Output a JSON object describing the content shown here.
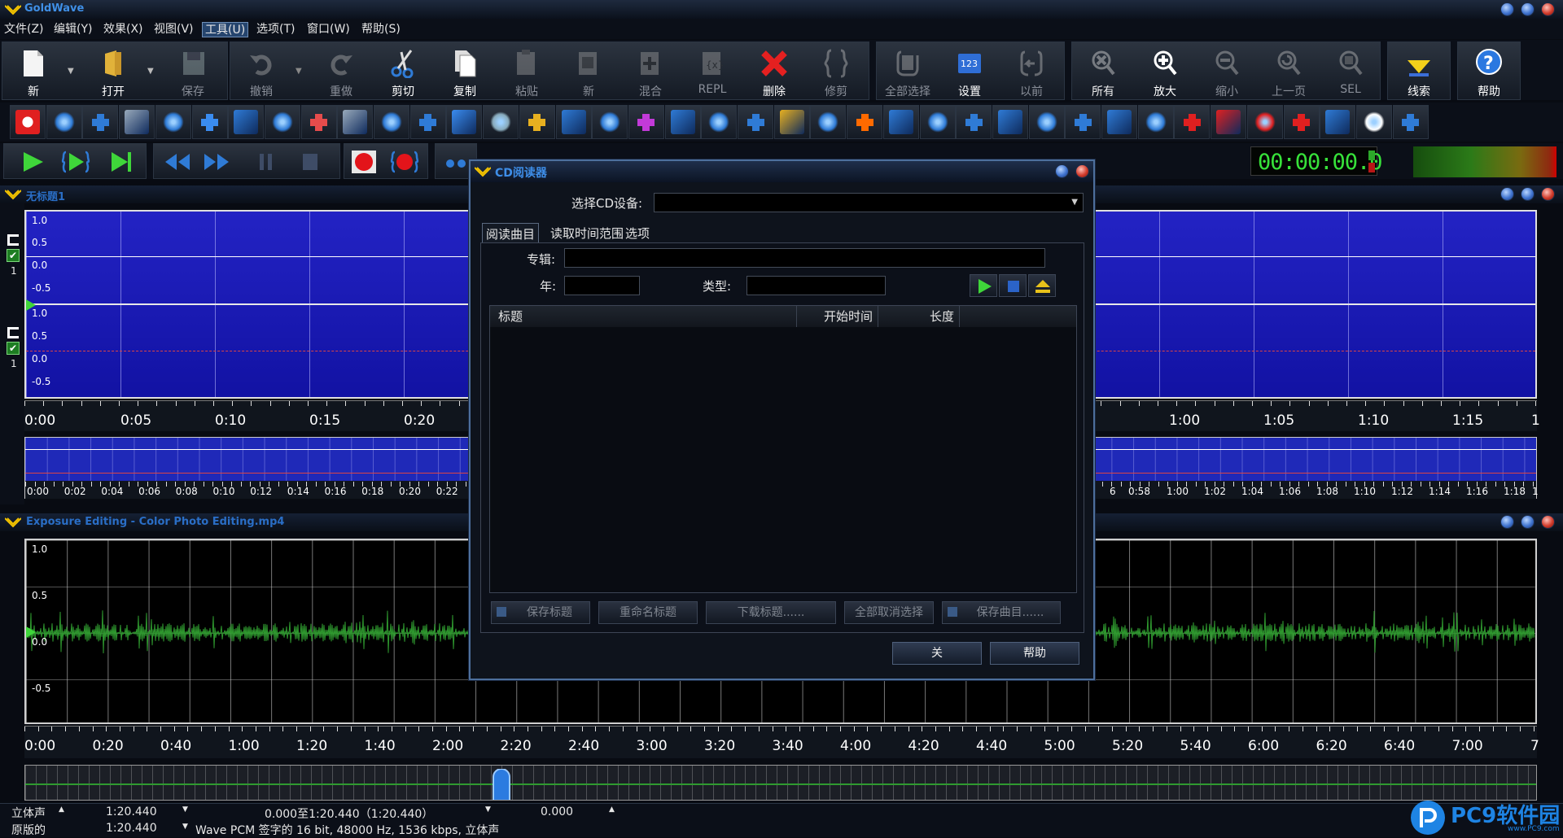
{
  "app": {
    "title": "GoldWave"
  },
  "menu": [
    "文件(Z)",
    "编辑(Y)",
    "效果(X)",
    "视图(V)",
    "工具(U)",
    "选项(T)",
    "窗口(W)",
    "帮助(S)"
  ],
  "toolbar": {
    "new": "新",
    "open": "打开",
    "save": "保存",
    "undo": "撤销",
    "redo": "重做",
    "cut": "剪切",
    "copy": "复制",
    "paste": "粘贴",
    "paste_new": "新",
    "mix": "混合",
    "replace": "REPL",
    "delete": "删除",
    "trim": "修剪",
    "select_all": "全部选择",
    "settings": "设置",
    "previous": "以前",
    "zoom_all": "所有",
    "zoom_in": "放大",
    "zoom_out": "缩小",
    "prev_page": "上一页",
    "sel": "SEL",
    "cue": "线索",
    "help": "帮助"
  },
  "time_display": "00:00:00.0",
  "panel1": {
    "title": "无标题1",
    "ylabels_top": [
      "1.0",
      "0.5",
      "0.0",
      "-0.5"
    ],
    "ylabels_bottom": [
      "1.0",
      "0.5",
      "0.0",
      "-0.5"
    ],
    "channel_num": "1",
    "ruler_left": [
      "0:00",
      "0:05",
      "0:10",
      "0:15",
      "0:20"
    ],
    "ruler_right": [
      "1:00",
      "1:05",
      "1:10",
      "1:15",
      "1"
    ],
    "overview_left": [
      "0:00",
      "0:02",
      "0:04",
      "0:06",
      "0:08",
      "0:10",
      "0:12",
      "0:14",
      "0:16",
      "0:18",
      "0:20",
      "0:22"
    ],
    "overview_right": [
      "6",
      "0:58",
      "1:00",
      "1:02",
      "1:04",
      "1:06",
      "1:08",
      "1:10",
      "1:12",
      "1:14",
      "1:16",
      "1:18",
      "1"
    ]
  },
  "panel2": {
    "title": "Exposure Editing - Color Photo Editing.mp4",
    "ylabels": [
      "1.0",
      "0.5",
      "0.0",
      "-0.5"
    ],
    "ruler": [
      "0:00",
      "0:20",
      "0:40",
      "1:00",
      "1:20",
      "1:40",
      "2:00",
      "2:20",
      "2:40",
      "3:00",
      "3:20",
      "3:40",
      "4:00",
      "4:20",
      "4:40",
      "5:00",
      "5:20",
      "5:40",
      "6:00",
      "6:20",
      "6:40",
      "7:00",
      "7"
    ]
  },
  "status": {
    "row1_channel": "立体声",
    "row1_length": "1:20.440",
    "row1_selection": "0.000至1:20.440（1:20.440）",
    "row1_position": "0.000",
    "row2_label": "原版的",
    "row2_length": "1:20.440",
    "row2_format": "Wave PCM 签字的 16 bit, 48000 Hz, 1536 kbps, 立体声"
  },
  "dialog": {
    "title": "CD阅读器",
    "device_label": "选择CD设备:",
    "device_value": "",
    "tabs": [
      "阅读曲目",
      "读取时间范围",
      "选项"
    ],
    "album_label": "专辑:",
    "album_value": "",
    "year_label": "年:",
    "year_value": "",
    "genre_label": "类型:",
    "genre_value": "",
    "columns": [
      "标题",
      "开始时间",
      "长度"
    ],
    "buttons": [
      "保存标题",
      "重命名标题",
      "下载标题......",
      "全部取消选择",
      "保存曲目......"
    ],
    "close": "关",
    "help": "帮助"
  },
  "watermark": {
    "text": "PC9软件园",
    "sub": "www.PC9.com"
  },
  "colors": {
    "accent": "#3f8fe6",
    "wave_bg": "#1d1db1",
    "waveform": "#2f9a2f",
    "time": "#37e23a"
  }
}
